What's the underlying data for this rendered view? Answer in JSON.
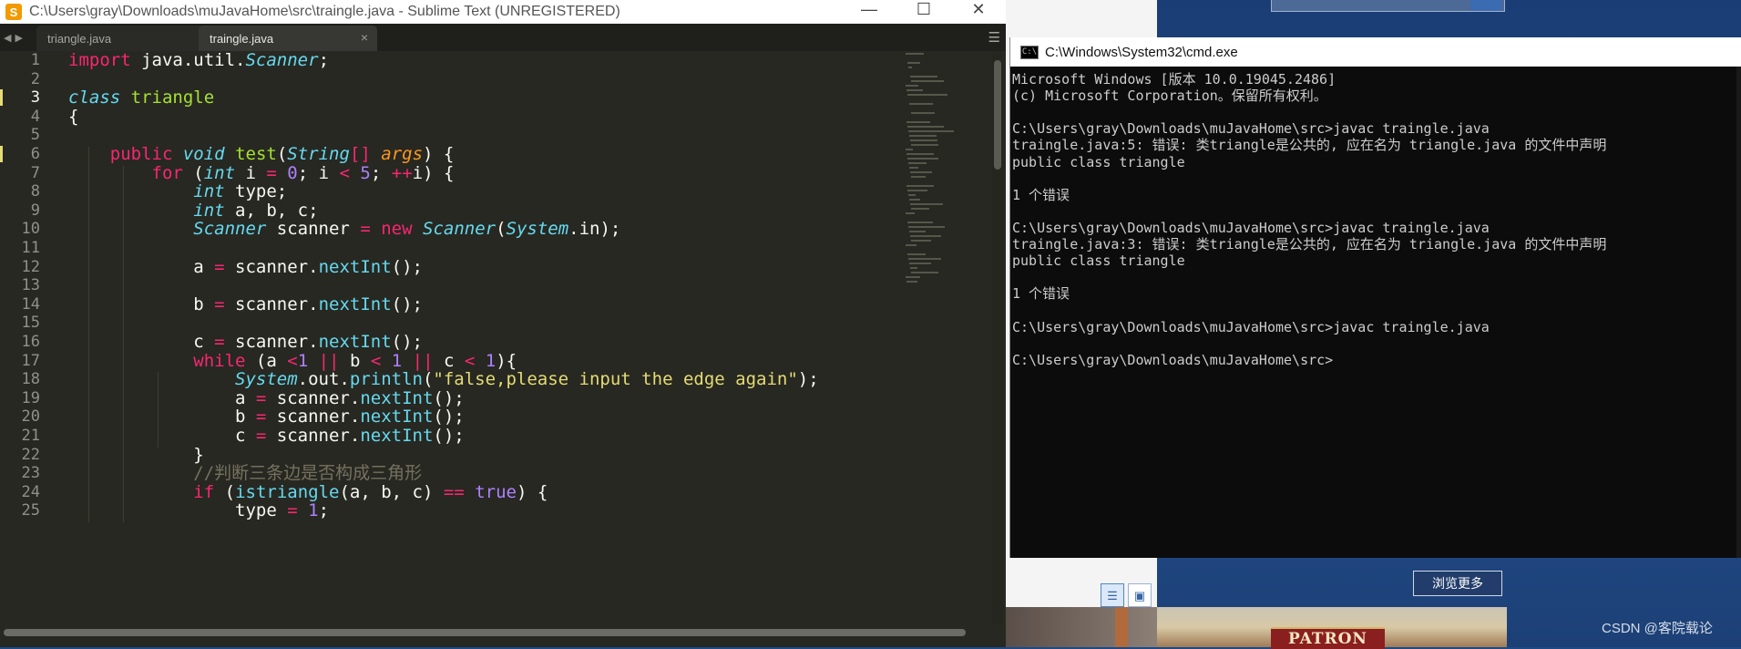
{
  "sublime": {
    "title": "C:\\Users\\gray\\Downloads\\muJavaHome\\src\\traingle.java - Sublime Text (UNREGISTERED)",
    "tabs": [
      {
        "label": "triangle.java",
        "active": false
      },
      {
        "label": "traingle.java",
        "active": true
      }
    ],
    "tab_close_glyph": "×",
    "window_controls": {
      "minimize": "—",
      "maximize": "☐",
      "close": "✕"
    },
    "line_numbers": [
      "1",
      "2",
      "3",
      "4",
      "5",
      "6",
      "7",
      "8",
      "9",
      "10",
      "11",
      "12",
      "13",
      "14",
      "15",
      "16",
      "17",
      "18",
      "19",
      "20",
      "21",
      "22",
      "23",
      "24",
      "25"
    ],
    "highlighted_line": "3",
    "code": [
      [
        [
          "kw",
          "import"
        ],
        [
          "plain",
          " java.util."
        ],
        [
          "typ",
          "Scanner"
        ],
        [
          "plain",
          ";"
        ]
      ],
      [],
      [
        [
          "kwi",
          "class"
        ],
        [
          "plain",
          " "
        ],
        [
          "cls",
          "triangle"
        ]
      ],
      [
        [
          "plain",
          "{"
        ]
      ],
      [],
      [
        [
          "plain",
          "    "
        ],
        [
          "kw",
          "public"
        ],
        [
          "plain",
          " "
        ],
        [
          "kwi",
          "void"
        ],
        [
          "plain",
          " "
        ],
        [
          "fn",
          "test"
        ],
        [
          "plain",
          "("
        ],
        [
          "typ",
          "String"
        ],
        [
          "op",
          "[]"
        ],
        [
          "plain",
          " "
        ],
        [
          "arg",
          "args"
        ],
        [
          "plain",
          ") {"
        ]
      ],
      [
        [
          "plain",
          "        "
        ],
        [
          "kw",
          "for"
        ],
        [
          "plain",
          " ("
        ],
        [
          "kwi",
          "int"
        ],
        [
          "plain",
          " i "
        ],
        [
          "op",
          "="
        ],
        [
          "plain",
          " "
        ],
        [
          "num",
          "0"
        ],
        [
          "plain",
          "; i "
        ],
        [
          "op",
          "<"
        ],
        [
          "plain",
          " "
        ],
        [
          "num",
          "5"
        ],
        [
          "plain",
          "; "
        ],
        [
          "op",
          "++"
        ],
        [
          "plain",
          "i) {"
        ]
      ],
      [
        [
          "plain",
          "            "
        ],
        [
          "kwi",
          "int"
        ],
        [
          "plain",
          " type;"
        ]
      ],
      [
        [
          "plain",
          "            "
        ],
        [
          "kwi",
          "int"
        ],
        [
          "plain",
          " a, b, c;"
        ]
      ],
      [
        [
          "plain",
          "            "
        ],
        [
          "typ",
          "Scanner"
        ],
        [
          "plain",
          " scanner "
        ],
        [
          "op",
          "="
        ],
        [
          "plain",
          " "
        ],
        [
          "kw",
          "new"
        ],
        [
          "plain",
          " "
        ],
        [
          "typ",
          "Scanner"
        ],
        [
          "plain",
          "("
        ],
        [
          "typ",
          "System"
        ],
        [
          "plain",
          ".in);"
        ]
      ],
      [],
      [
        [
          "plain",
          "            a "
        ],
        [
          "op",
          "="
        ],
        [
          "plain",
          " scanner."
        ],
        [
          "meth",
          "nextInt"
        ],
        [
          "plain",
          "();"
        ]
      ],
      [],
      [
        [
          "plain",
          "            b "
        ],
        [
          "op",
          "="
        ],
        [
          "plain",
          " scanner."
        ],
        [
          "meth",
          "nextInt"
        ],
        [
          "plain",
          "();"
        ]
      ],
      [],
      [
        [
          "plain",
          "            c "
        ],
        [
          "op",
          "="
        ],
        [
          "plain",
          " scanner."
        ],
        [
          "meth",
          "nextInt"
        ],
        [
          "plain",
          "();"
        ]
      ],
      [
        [
          "plain",
          "            "
        ],
        [
          "kw",
          "while"
        ],
        [
          "plain",
          " (a "
        ],
        [
          "op",
          "<"
        ],
        [
          "num",
          "1"
        ],
        [
          "plain",
          " "
        ],
        [
          "op",
          "||"
        ],
        [
          "plain",
          " b "
        ],
        [
          "op",
          "<"
        ],
        [
          "plain",
          " "
        ],
        [
          "num",
          "1"
        ],
        [
          "plain",
          " "
        ],
        [
          "op",
          "||"
        ],
        [
          "plain",
          " c "
        ],
        [
          "op",
          "<"
        ],
        [
          "plain",
          " "
        ],
        [
          "num",
          "1"
        ],
        [
          "plain",
          "){"
        ]
      ],
      [
        [
          "plain",
          "                "
        ],
        [
          "typ",
          "System"
        ],
        [
          "plain",
          ".out."
        ],
        [
          "meth",
          "println"
        ],
        [
          "plain",
          "("
        ],
        [
          "str",
          "\"false,please input the edge again\""
        ],
        [
          "plain",
          ");"
        ]
      ],
      [
        [
          "plain",
          "                a "
        ],
        [
          "op",
          "="
        ],
        [
          "plain",
          " scanner."
        ],
        [
          "meth",
          "nextInt"
        ],
        [
          "plain",
          "();"
        ]
      ],
      [
        [
          "plain",
          "                b "
        ],
        [
          "op",
          "="
        ],
        [
          "plain",
          " scanner."
        ],
        [
          "meth",
          "nextInt"
        ],
        [
          "plain",
          "();"
        ]
      ],
      [
        [
          "plain",
          "                c "
        ],
        [
          "op",
          "="
        ],
        [
          "plain",
          " scanner."
        ],
        [
          "meth",
          "nextInt"
        ],
        [
          "plain",
          "();"
        ]
      ],
      [
        [
          "plain",
          "            }"
        ]
      ],
      [
        [
          "plain",
          "            "
        ],
        [
          "cm",
          "//判断三条边是否构成三角形"
        ]
      ],
      [
        [
          "plain",
          "            "
        ],
        [
          "kw",
          "if"
        ],
        [
          "plain",
          " ("
        ],
        [
          "meth",
          "istriangle"
        ],
        [
          "plain",
          "(a, b, c) "
        ],
        [
          "op",
          "=="
        ],
        [
          "plain",
          " "
        ],
        [
          "num",
          "true"
        ],
        [
          "plain",
          ") {"
        ]
      ],
      [
        [
          "plain",
          "                type "
        ],
        [
          "op",
          "="
        ],
        [
          "plain",
          " "
        ],
        [
          "num",
          "1"
        ],
        [
          "plain",
          ";"
        ]
      ]
    ]
  },
  "cmd": {
    "title": "C:\\Windows\\System32\\cmd.exe",
    "icon_label": "C:\\",
    "lines": [
      "Microsoft Windows [版本 10.0.19045.2486]",
      "(c) Microsoft Corporation。保留所有权利。",
      "",
      "C:\\Users\\gray\\Downloads\\muJavaHome\\src>javac traingle.java",
      "traingle.java:5: 错误: 类triangle是公共的, 应在名为 triangle.java 的文件中声明",
      "public class triangle",
      "",
      "1 个错误",
      "",
      "C:\\Users\\gray\\Downloads\\muJavaHome\\src>javac traingle.java",
      "traingle.java:3: 错误: 类triangle是公共的, 应在名为 triangle.java 的文件中声明",
      "public class triangle",
      "",
      "1 个错误",
      "",
      "C:\\Users\\gray\\Downloads\\muJavaHome\\src>javac traingle.java",
      "",
      "C:\\Users\\gray\\Downloads\\muJavaHome\\src>"
    ]
  },
  "background": {
    "browse_more_label": "浏览更多",
    "patron_label": "PATRON",
    "watermark": "CSDN @客院载论"
  },
  "colors": {
    "editor_bg": "#272822",
    "keyword": "#f92672",
    "type": "#66d9ef",
    "function": "#a6e22e",
    "string": "#e6db74",
    "number": "#ae81ff",
    "comment": "#75715e",
    "cmd_bg": "#0c0c0c",
    "cmd_text": "#cccccc"
  }
}
